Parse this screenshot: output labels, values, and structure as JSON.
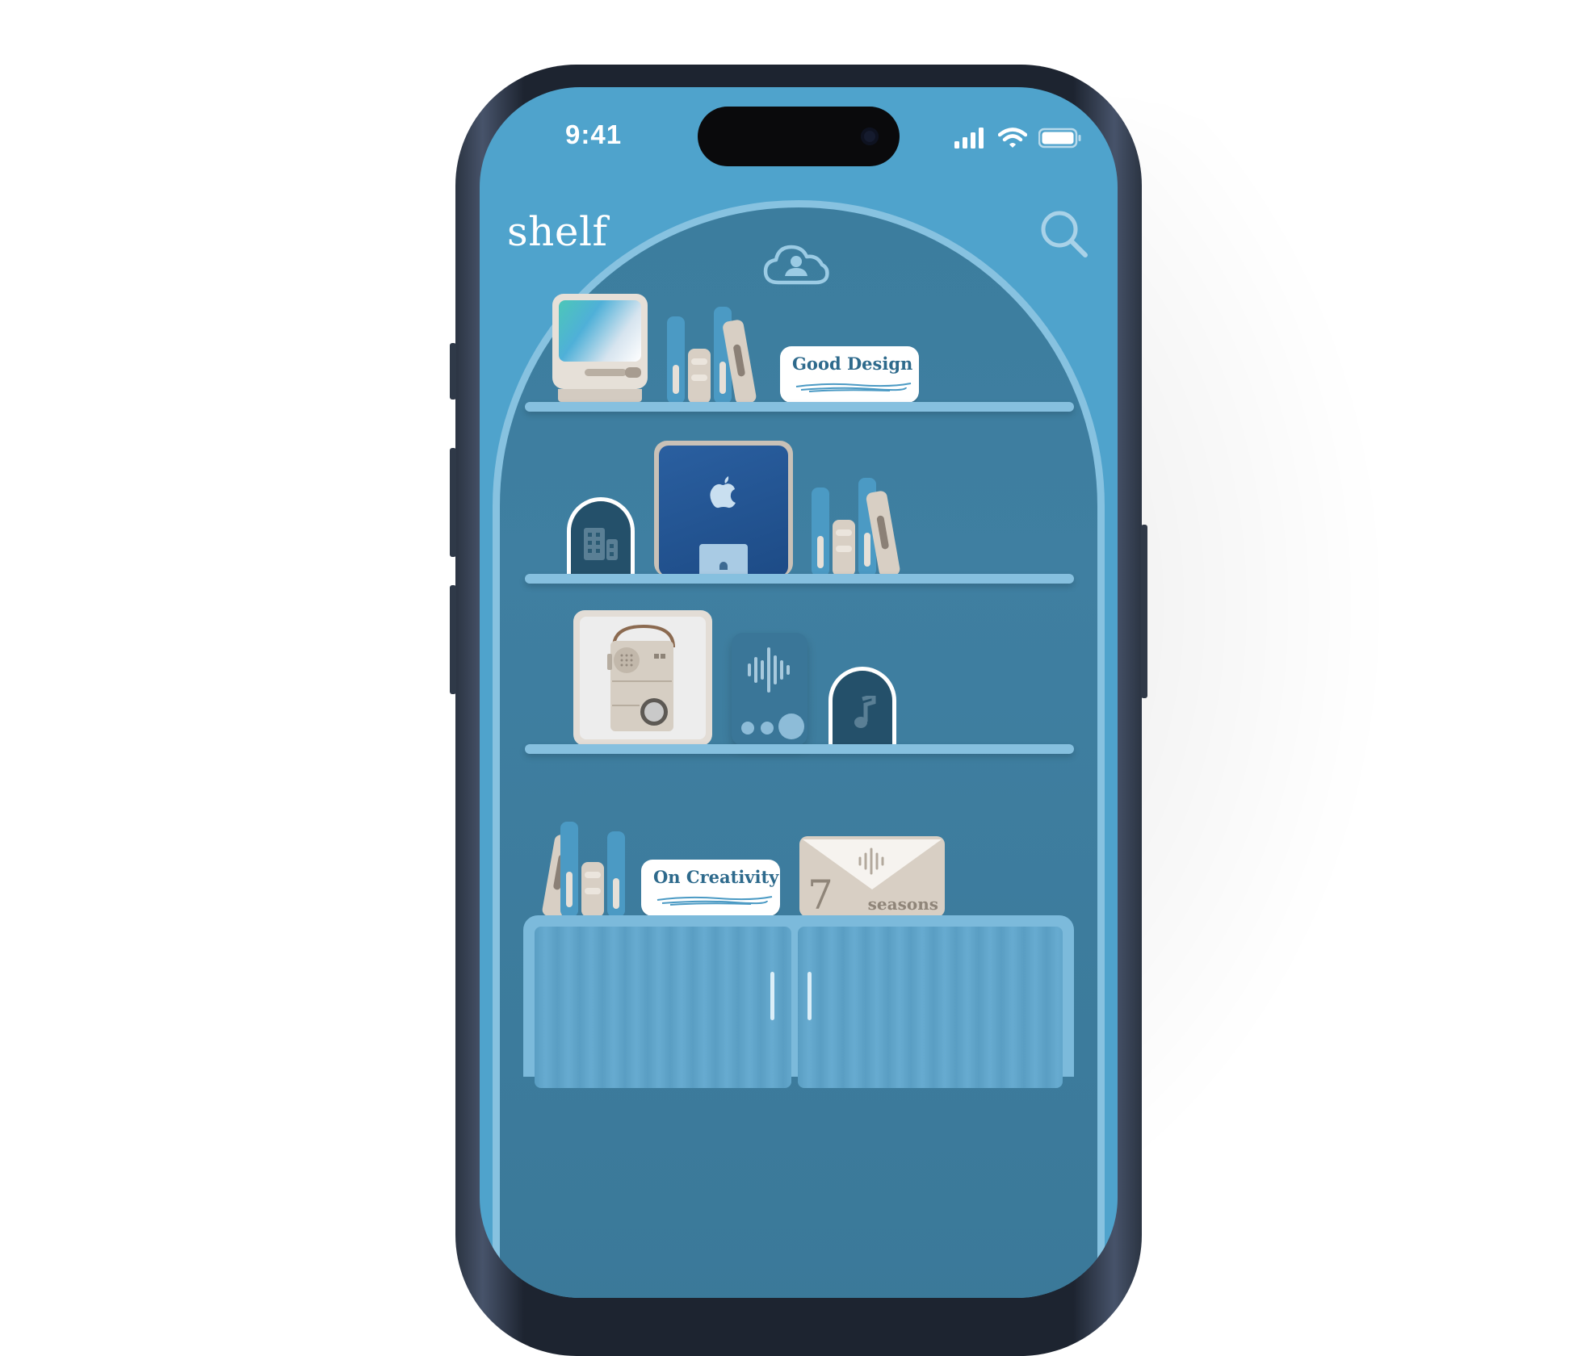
{
  "status_bar": {
    "time": "9:41"
  },
  "header": {
    "title": "shelf"
  },
  "cards": {
    "good_design": "Good Design",
    "on_creativity": "On Creativity",
    "seasons_number": "7",
    "seasons_label": "seasons"
  },
  "icons": {
    "search": "search-icon",
    "cloud": "cloud-profile-icon",
    "building": "building-icon",
    "music": "music-note-icon",
    "waveform": "waveform-icon",
    "apple": "apple-logo-icon"
  },
  "colors": {
    "screen_bg": "#4fa3cc",
    "arch_bg": "#3d7fa0",
    "shelf": "#86c0df",
    "accent_blue": "#4b9ac4",
    "beige": "#d8cfc4",
    "navy": "#1f4f86"
  }
}
